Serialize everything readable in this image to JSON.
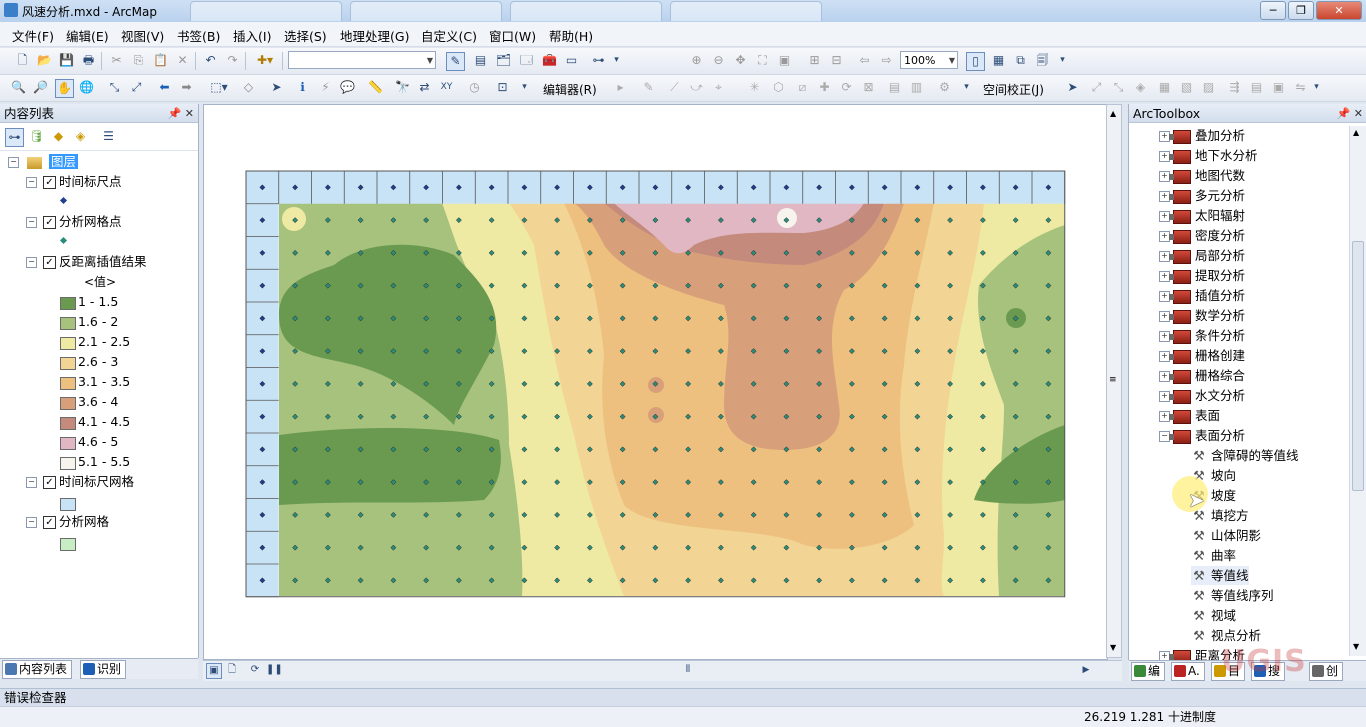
{
  "window": {
    "title": "风速分析.mxd - ArcMap",
    "controls": [
      "─",
      "❐",
      "✕"
    ]
  },
  "menubar": {
    "items": [
      "文件(F)",
      "编辑(E)",
      "视图(V)",
      "书签(B)",
      "插入(I)",
      "选择(S)",
      "地理处理(G)",
      "自定义(C)",
      "窗口(W)",
      "帮助(H)"
    ]
  },
  "toolbar": {
    "scale_value": "",
    "zoom_percent": "100%",
    "editor_label": "编辑器(R)",
    "georef_label": "空间校正(J)"
  },
  "toc": {
    "title": "内容列表",
    "root_label": "图层",
    "layers": [
      {
        "name": "时间标尺点",
        "checked": true
      },
      {
        "name": "分析网格点",
        "checked": true
      },
      {
        "name": "反距离插值结果",
        "checked": true,
        "value_header": "<值>"
      },
      {
        "name": "时间标尺网格",
        "checked": true
      },
      {
        "name": "分析网格",
        "checked": true
      }
    ],
    "idw_classes": [
      {
        "label": "1 - 1.5",
        "color": "#6a9a50"
      },
      {
        "label": "1.6 - 2",
        "color": "#a6c27c"
      },
      {
        "label": "2.1 - 2.5",
        "color": "#efeaa3"
      },
      {
        "label": "2.6 - 3",
        "color": "#f2d594"
      },
      {
        "label": "3.1 - 3.5",
        "color": "#edc07f"
      },
      {
        "label": "3.6 - 4",
        "color": "#d8a07a"
      },
      {
        "label": "4.1 - 4.5",
        "color": "#c48a7c"
      },
      {
        "label": "4.6 - 5",
        "color": "#e0b7c2"
      },
      {
        "label": "5.1 - 5.5",
        "color": "#f7f4ee"
      }
    ],
    "time_grid_color": "#c9e3f6",
    "analysis_grid_color": "#c8ecc4",
    "tabs": [
      "内容列表",
      "识别"
    ]
  },
  "arctoolbox": {
    "title": "ArcToolbox",
    "toolsets": [
      "叠加分析",
      "地下水分析",
      "地图代数",
      "多元分析",
      "太阳辐射",
      "密度分析",
      "局部分析",
      "提取分析",
      "插值分析",
      "数学分析",
      "条件分析",
      "栅格创建",
      "栅格综合",
      "水文分析",
      "表面"
    ],
    "expanded_toolset": "表面分析",
    "tools": [
      "含障碍的等值线",
      "坡向",
      "坡度",
      "填挖方",
      "山体阴影",
      "曲率",
      "等值线",
      "等值线序列",
      "视域",
      "视点分析"
    ],
    "partial_next": "距离分析",
    "bottom_tabs": [
      "编",
      "A.",
      "目",
      "搜",
      "创"
    ]
  },
  "error_bar": {
    "label": "错误检查器"
  },
  "status": {
    "coords": "26.219  1.281 十进制度"
  },
  "watermark": "UGIS"
}
